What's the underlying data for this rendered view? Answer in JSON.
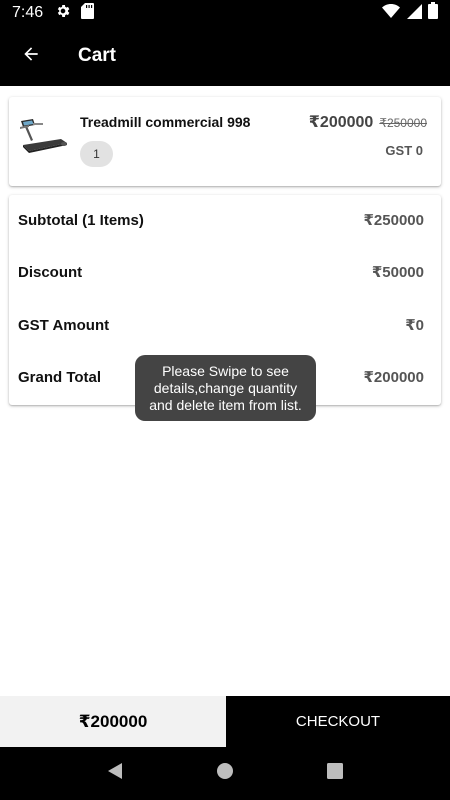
{
  "status_bar": {
    "time": "7:46",
    "left_icons": [
      "gear-icon",
      "sd-card-icon"
    ],
    "right_icons": [
      "wifi-icon",
      "signal-icon",
      "battery-icon"
    ]
  },
  "app_bar": {
    "back_icon": "arrow-left-icon",
    "title": "Cart"
  },
  "cart_item": {
    "image_icon": "treadmill-image",
    "name": "Treadmill commercial 998",
    "quantity": "1",
    "price": "₹200000",
    "original_price": "₹250000",
    "gst": "GST 0"
  },
  "summary": {
    "subtotal_label": "Subtotal (1 Items)",
    "subtotal_value": "₹250000",
    "discount_label": "Discount",
    "discount_value": "₹50000",
    "gst_label": "GST Amount",
    "gst_value": "₹0",
    "grand_total_label": "Grand Total",
    "grand_total_value": "₹200000"
  },
  "toast": {
    "message": "Please Swipe to see details,change quantity and delete item from list."
  },
  "bottom_bar": {
    "total": "₹200000",
    "checkout_label": "CHECKOUT"
  },
  "nav_bar": {
    "icons": [
      "back-triangle-icon",
      "home-circle-icon",
      "recents-square-icon"
    ]
  },
  "colors": {
    "app_bar_bg": "#000000",
    "toast_bg": "#444444",
    "total_box_bg": "#f2f2f2",
    "checkout_bg": "#000000"
  }
}
